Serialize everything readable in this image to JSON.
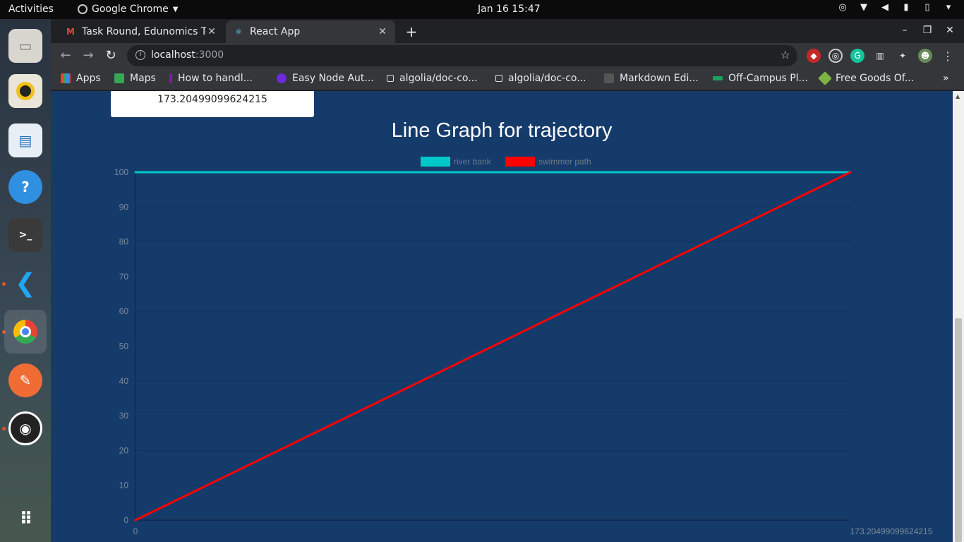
{
  "system": {
    "activities": "Activities",
    "app_name": "Google Chrome",
    "clock": "Jan 16  15:47"
  },
  "browser": {
    "tabs": [
      {
        "title": "Task Round, Edunomics Te",
        "active": false
      },
      {
        "title": "React App",
        "active": true
      }
    ],
    "url_host": "localhost",
    "url_port": ":3000",
    "bookmarks": [
      {
        "label": "Apps",
        "color": "#4285f4"
      },
      {
        "label": "Maps",
        "color": "#34a853"
      },
      {
        "label": "How to handl...",
        "color": "#7b1fa2"
      },
      {
        "label": "Easy Node Aut...",
        "color": "#6c2bd9"
      },
      {
        "label": "algolia/doc-co...",
        "color": "#e8eaed"
      },
      {
        "label": "algolia/doc-co...",
        "color": "#e8eaed"
      },
      {
        "label": "Markdown Edi...",
        "color": "#555555"
      },
      {
        "label": "Off-Campus Pl...",
        "color": "#1aa260"
      },
      {
        "label": "Free Goods Of...",
        "color": "#7cb342"
      }
    ]
  },
  "page": {
    "result_value": "173.20499099624215",
    "chart_title": "Line Graph for trajectory"
  },
  "chart_data": {
    "type": "line",
    "title": "Line Graph for trajectory",
    "xlabel": "",
    "ylabel": "",
    "x_ticks": [
      "0",
      "173.20499099624215"
    ],
    "y_ticks": [
      "0",
      "10",
      "20",
      "30",
      "40",
      "50",
      "60",
      "70",
      "80",
      "90",
      "100"
    ],
    "xlim": [
      0,
      173.20499099624215
    ],
    "ylim": [
      0,
      100
    ],
    "legend_position": "top",
    "grid": true,
    "series": [
      {
        "name": "river bank",
        "color": "#00c8c8",
        "x": [
          0,
          173.20499099624215
        ],
        "y": [
          100,
          100
        ]
      },
      {
        "name": "swimmer path",
        "color": "#ff0000",
        "x": [
          0,
          173.20499099624215
        ],
        "y": [
          0,
          100
        ]
      }
    ]
  }
}
